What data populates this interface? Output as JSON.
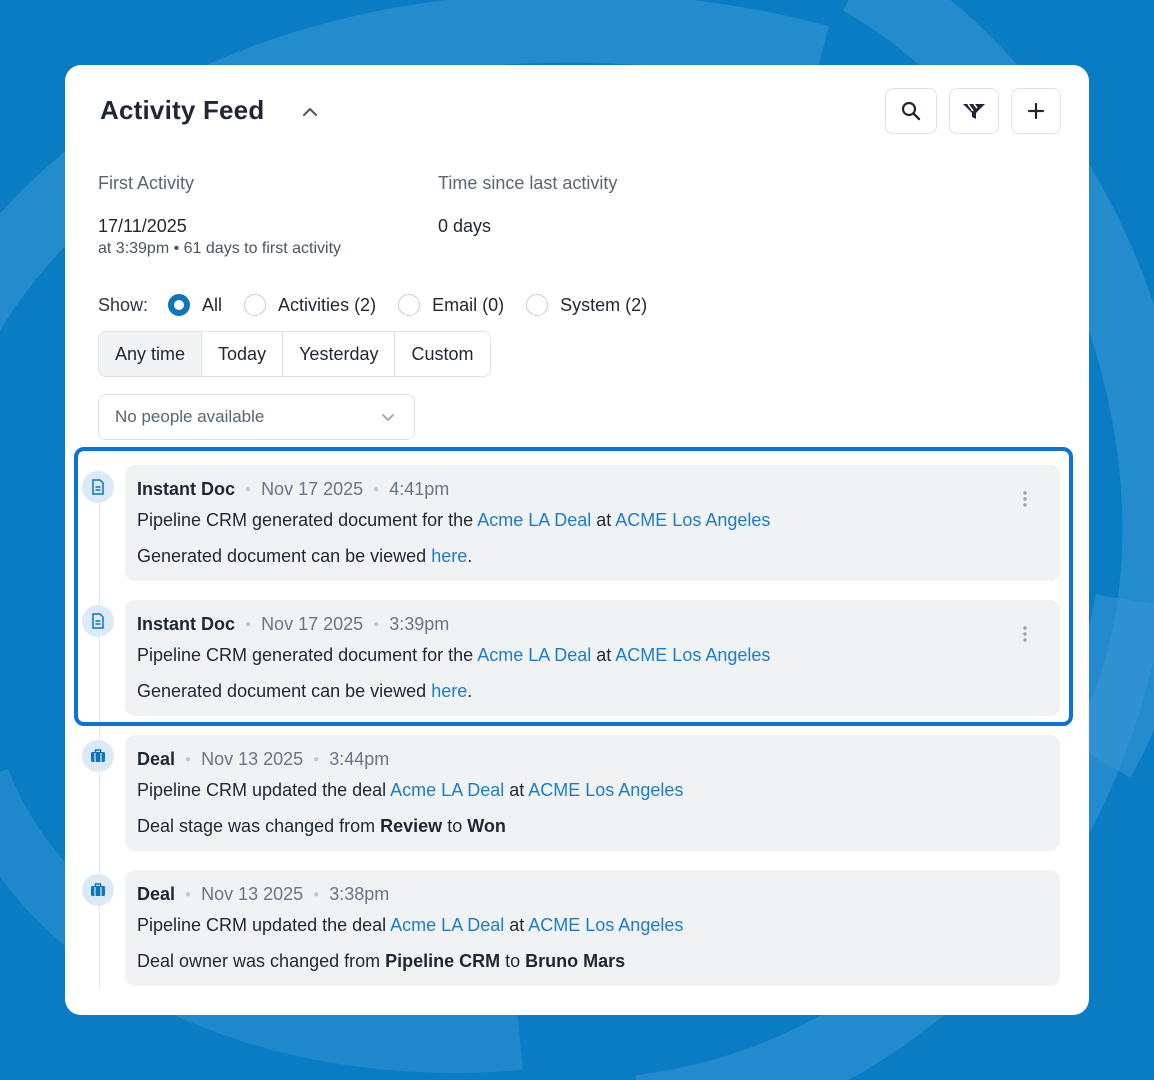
{
  "colors": {
    "brand_bg": "#0a7cc4",
    "link": "#1b7dc4",
    "highlight": "#0b72d6",
    "radio_checked": "#1173b8"
  },
  "header": {
    "title": "Activity Feed",
    "collapse_icon": "chevron-up-icon",
    "actions": [
      {
        "name": "search-button",
        "icon": "search-icon"
      },
      {
        "name": "filter-button",
        "icon": "filter-icon"
      },
      {
        "name": "add-button",
        "icon": "plus-icon"
      }
    ]
  },
  "stats": {
    "first_activity": {
      "label": "First Activity",
      "value": "17/11/2025",
      "sub": "at 3:39pm • 61 days to first activity"
    },
    "time_since": {
      "label": "Time since last activity",
      "value": "0 days"
    }
  },
  "show": {
    "label": "Show:",
    "options": [
      "All",
      "Activities (2)",
      "Email (0)",
      "System (2)"
    ],
    "selected": "All"
  },
  "time_tabs": {
    "options": [
      "Any time",
      "Today",
      "Yesterday",
      "Custom"
    ],
    "selected": "Any time"
  },
  "people_select": {
    "value": "No people available"
  },
  "entries": [
    {
      "icon": "document-icon",
      "type": "Instant Doc",
      "date": "Nov 17 2025",
      "time": "4:41pm",
      "line1": {
        "prefix": "Pipeline CRM generated document for the ",
        "link1": "Acme LA Deal",
        "mid": " at ",
        "link2": "ACME Los Angeles"
      },
      "line2": {
        "text": "Generated document can be viewed ",
        "link": "here",
        "suffix": "."
      }
    },
    {
      "icon": "document-icon",
      "type": "Instant Doc",
      "date": "Nov 17 2025",
      "time": "3:39pm",
      "line1": {
        "prefix": "Pipeline CRM generated document for the ",
        "link1": "Acme LA Deal",
        "mid": " at ",
        "link2": "ACME Los Angeles"
      },
      "line2": {
        "text": "Generated document can be viewed ",
        "link": "here",
        "suffix": "."
      }
    },
    {
      "icon": "briefcase-icon",
      "type": "Deal",
      "date": "Nov 13 2025",
      "time": "3:44pm",
      "line1": {
        "prefix": "Pipeline CRM updated the deal ",
        "link1": "Acme LA Deal",
        "mid": " at ",
        "link2": "ACME Los Angeles"
      },
      "line2": {
        "text": "Deal stage was changed from ",
        "from": "Review",
        "to_word": " to ",
        "to": "Won"
      }
    },
    {
      "icon": "briefcase-icon",
      "type": "Deal",
      "date": "Nov 13 2025",
      "time": "3:38pm",
      "line1": {
        "prefix": "Pipeline CRM updated the deal ",
        "link1": "Acme LA Deal",
        "mid": " at ",
        "link2": "ACME Los Angeles"
      },
      "line2": {
        "text": "Deal owner was changed from ",
        "from": "Pipeline CRM",
        "to_word": " to ",
        "to": "Bruno Mars"
      }
    }
  ]
}
